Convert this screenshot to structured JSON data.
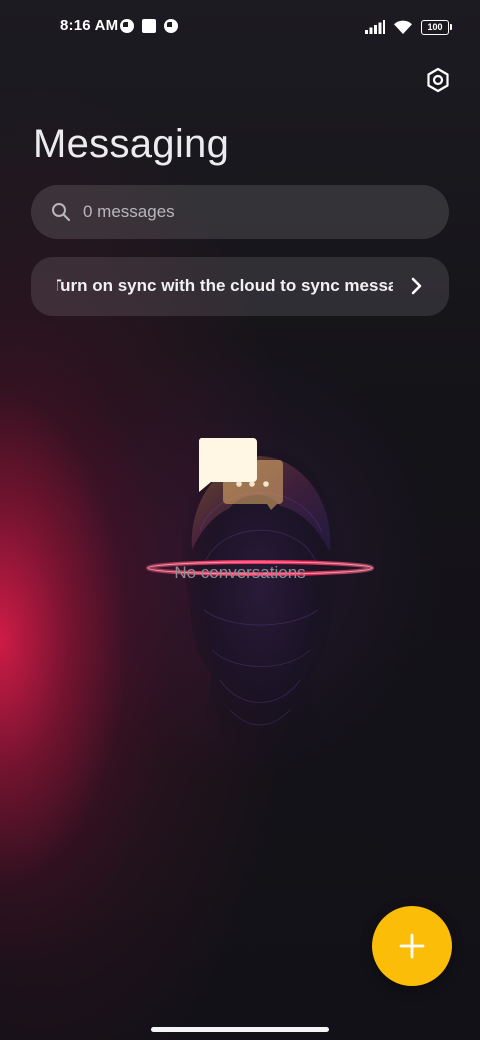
{
  "status_bar": {
    "time": "8:16 AM",
    "battery": "100",
    "left_icons": [
      "notification-icon",
      "stop-icon",
      "notification-icon"
    ],
    "right_icons": [
      "signal-icon",
      "wifi-icon",
      "battery-icon"
    ]
  },
  "header": {
    "title": "Messaging",
    "settings_icon": "settings-icon"
  },
  "search": {
    "placeholder": "0 messages",
    "icon": "search-icon"
  },
  "sync_banner": {
    "text": "Turn on sync with the cloud to sync messages",
    "icon": "chevron-right-icon"
  },
  "empty_state": {
    "label": "No conversations",
    "icon": "chat-bubbles-icon"
  },
  "fab": {
    "icon": "plus-icon",
    "color": "#fbbd08"
  },
  "colors": {
    "accent": "#fbbd08",
    "glow": "#d71c48",
    "background": "#111016"
  }
}
